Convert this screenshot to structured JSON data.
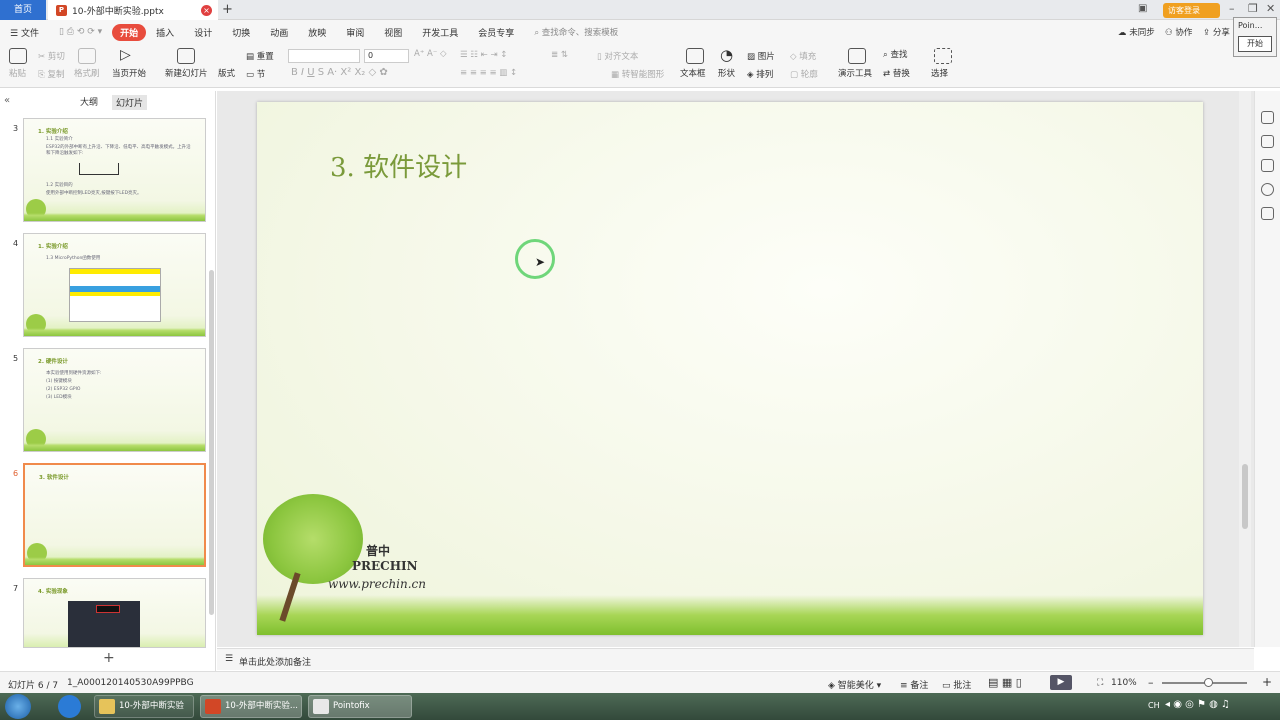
{
  "titlebar": {
    "home_tab": "首页",
    "file_tab": "10-外部中断实验.pptx",
    "visitor": "访客登录"
  },
  "menu": {
    "file": "文件",
    "items": [
      "开始",
      "插入",
      "设计",
      "切换",
      "动画",
      "放映",
      "审阅",
      "视图",
      "开发工具",
      "会员专享"
    ],
    "search": "查找命令、搜索模板",
    "sync": "未同步",
    "collab": "协作",
    "share": "分享"
  },
  "ribbon": {
    "paste": "粘贴",
    "cut": "剪切",
    "copy": "复制",
    "format_painter": "格式刷",
    "play_from_current": "当页开始",
    "new_slide": "新建幻灯片",
    "layout": "版式",
    "section": "节",
    "reset": "重置",
    "font_size": "0",
    "align_text": "对齐文本",
    "smartart": "转智能图形",
    "textbox": "文本框",
    "shape": "形状",
    "picture": "图片",
    "arrange": "排列",
    "fill": "填充",
    "outline": "轮廓",
    "presenter_tools": "演示工具",
    "find": "查找",
    "replace": "替换",
    "select": "选择"
  },
  "pointofix": {
    "title": "Poin...",
    "button": "开始"
  },
  "left_panel": {
    "tab_outline": "大纲",
    "tab_slides": "幻灯片"
  },
  "thumbnails": [
    {
      "num": "3",
      "title": "1. 实验介绍",
      "lines": [
        "1.1 实验简介",
        "ESP32的外部中断有上升沿、下降沿、低电平、高电平触发模式。上升沿",
        "和下降沿触发如下:",
        "1.2 实验目的",
        "使用外部中断控制LED亮灭,按键按下LED亮灭。"
      ]
    },
    {
      "num": "4",
      "title": "1. 实验介绍",
      "lines": [
        "1.3 MicroPython函数使用"
      ]
    },
    {
      "num": "5",
      "title": "2. 硬件设计",
      "lines": [
        "本实验使用到硬件资源如下:",
        "(1) 按键模块",
        "(2) ESP32 GPIO",
        "(3) LED模块"
      ]
    },
    {
      "num": "6",
      "title": "3. 软件设计",
      "lines": []
    },
    {
      "num": "7",
      "title": "4. 实验现象",
      "lines": []
    }
  ],
  "slide": {
    "title": "3. 软件设计",
    "brand_cn": "普中",
    "brand_en": "PRECHIN",
    "brand_url": "www.prechin.cn"
  },
  "notes": {
    "placeholder": "单击此处添加备注"
  },
  "status": {
    "slide_pos": "幻灯片 6 / 7",
    "doc_id": "1_A000120140530A99PPBG",
    "beautify": "智能美化",
    "notes_btn": "备注",
    "comment_btn": "批注",
    "zoom": "110%"
  },
  "taskbar": {
    "items": [
      "10-外部中断实验",
      "10-外部中断实验...",
      "Pointofix"
    ],
    "ime": "CH"
  }
}
